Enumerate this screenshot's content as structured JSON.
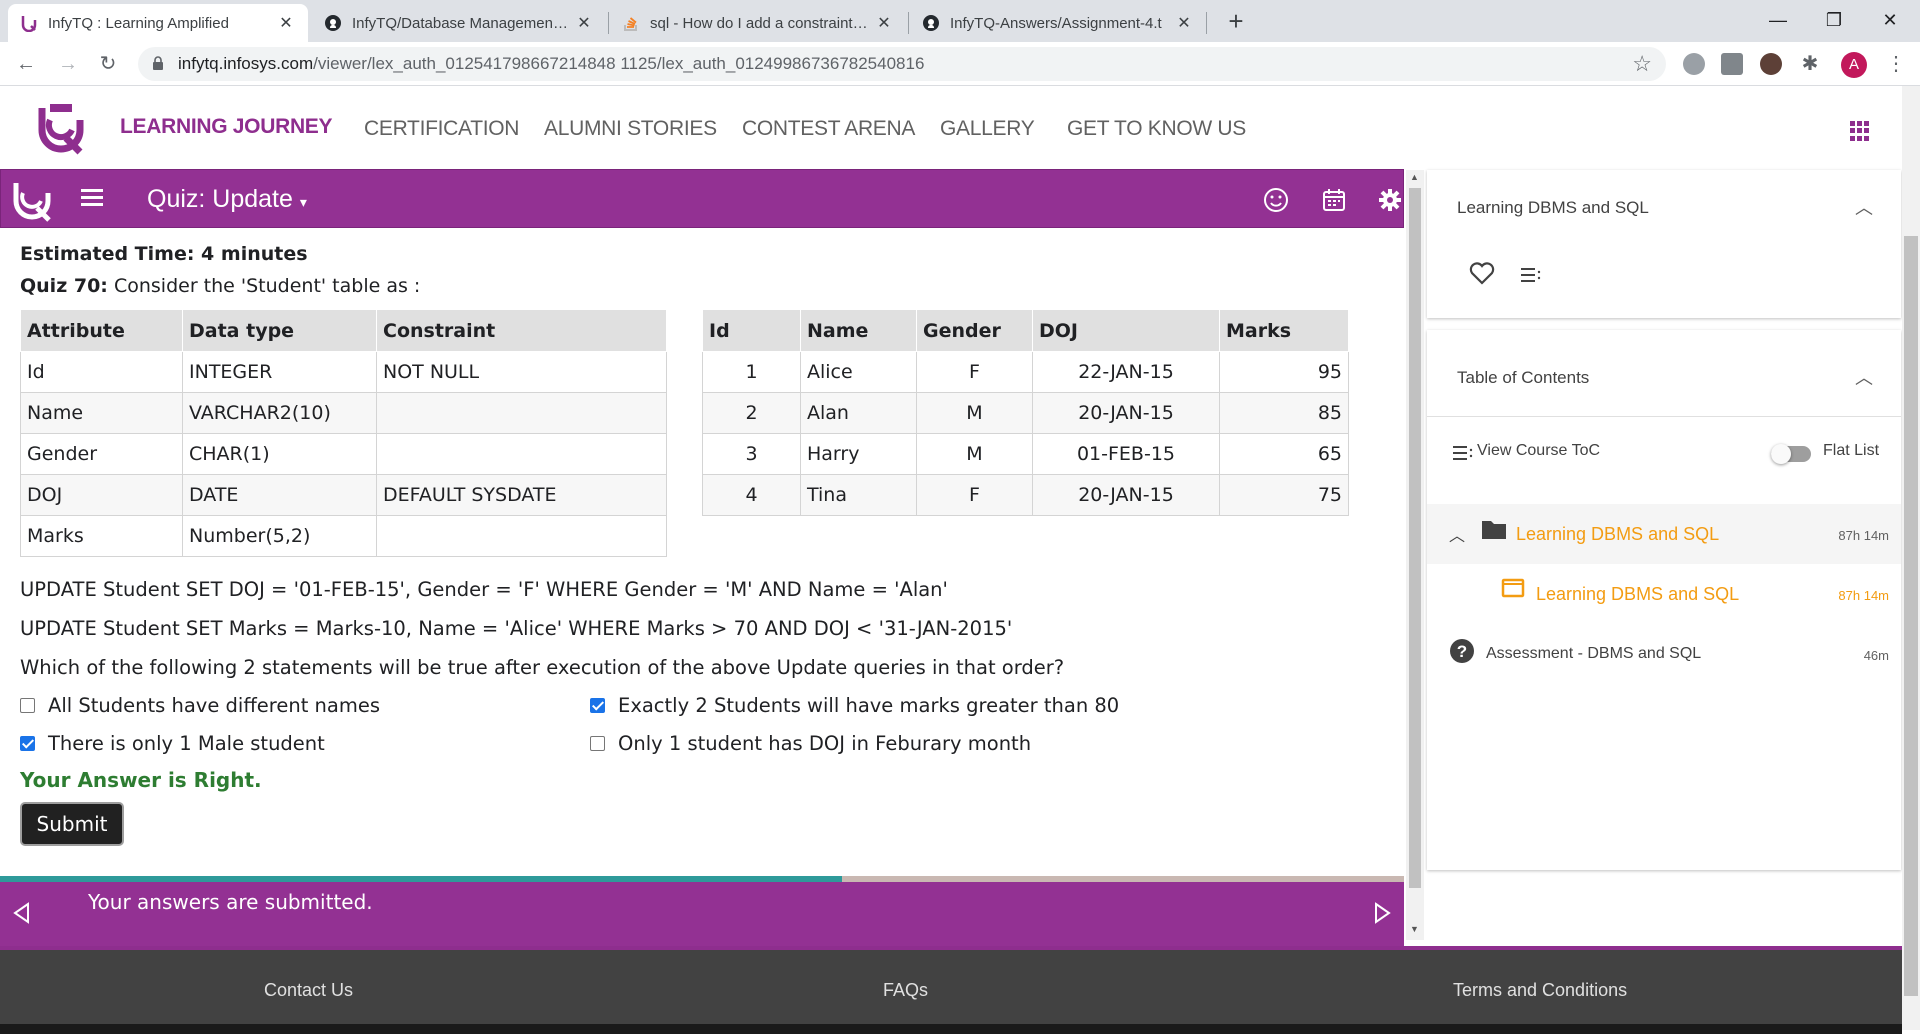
{
  "browser": {
    "tabs": [
      {
        "title": "InfyTQ : Learning Amplified"
      },
      {
        "title": "InfyTQ/Database Management Sy"
      },
      {
        "title": "sql - How do I add a constraint to"
      },
      {
        "title": "InfyTQ-Answers/Assignment-4.t"
      }
    ],
    "url_host": "infytq.infosys.com",
    "url_path": "/viewer/lex_auth_012541798667214848 1125/lex_auth_01249986736782540816",
    "avatar_letter": "A"
  },
  "site": {
    "nav": [
      {
        "label": "LEARNING JOURNEY"
      },
      {
        "label": "CERTIFICATION"
      },
      {
        "label": "ALUMNI STORIES"
      },
      {
        "label": "CONTEST ARENA"
      },
      {
        "label": "GALLERY"
      },
      {
        "label": "GET TO KNOW US"
      }
    ],
    "brand_color": "#933193"
  },
  "quiz": {
    "title": "Quiz: Update",
    "estimated_time": "Estimated Time: 4 minutes",
    "question_label": "Quiz 70:",
    "question_text": "Consider the 'Student' table as :",
    "schema": {
      "headers": [
        "Attribute",
        "Data type",
        "Constraint"
      ],
      "rows": [
        [
          "Id",
          "INTEGER",
          "NOT NULL"
        ],
        [
          "Name",
          "VARCHAR2(10)",
          ""
        ],
        [
          "Gender",
          "CHAR(1)",
          ""
        ],
        [
          "DOJ",
          "DATE",
          "DEFAULT SYSDATE"
        ],
        [
          "Marks",
          "Number(5,2)",
          ""
        ]
      ]
    },
    "data": {
      "headers": [
        "Id",
        "Name",
        "Gender",
        "DOJ",
        "Marks"
      ],
      "rows": [
        [
          "1",
          "Alice",
          "F",
          "22-JAN-15",
          "95"
        ],
        [
          "2",
          "Alan",
          "M",
          "20-JAN-15",
          "85"
        ],
        [
          "3",
          "Harry",
          "M",
          "01-FEB-15",
          "65"
        ],
        [
          "4",
          "Tina",
          "F",
          "20-JAN-15",
          "75"
        ]
      ]
    },
    "sql1": "UPDATE Student SET DOJ = '01-FEB-15', Gender = 'F' WHERE Gender = 'M' AND Name = 'Alan'",
    "sql2": "UPDATE Student SET Marks = Marks-10, Name = 'Alice' WHERE Marks > 70 AND DOJ < '31-JAN-2015'",
    "prompt": "Which of the following 2 statements will be true after execution of the above Update queries in that order?",
    "options": [
      {
        "label": "All Students have different names",
        "checked": false
      },
      {
        "label": "Exactly 2 Students will have marks greater than 80",
        "checked": true
      },
      {
        "label": "There is only 1 Male student",
        "checked": true
      },
      {
        "label": "Only 1 student has DOJ in Feburary month",
        "checked": false
      }
    ],
    "result": "Your Answer is Right.",
    "submit_label": "Submit",
    "submitted_msg": "Your answers are submitted.",
    "progress_fraction": 0.6
  },
  "sidebar": {
    "course_title": "Learning DBMS and SQL",
    "toc_title": "Table of Contents",
    "view_toc": "View Course ToC",
    "flat_list": "Flat List",
    "items": [
      {
        "label": "Learning DBMS and SQL",
        "time": "87h 14m"
      },
      {
        "label": "Learning DBMS and SQL",
        "time": "87h 14m"
      },
      {
        "label": "Assessment - DBMS and SQL",
        "time": "46m"
      }
    ]
  },
  "footer": {
    "contact": "Contact Us",
    "faqs": "FAQs",
    "terms": "Terms and Conditions"
  }
}
